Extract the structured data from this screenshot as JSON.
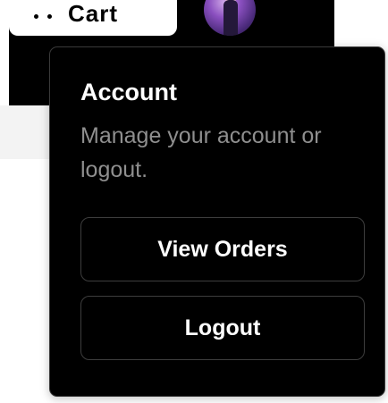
{
  "header": {
    "cart_label": "Cart",
    "avatar_alt": "user avatar"
  },
  "popover": {
    "title": "Account",
    "description": "Manage your account or logout.",
    "view_orders_label": "View Orders",
    "logout_label": "Logout"
  },
  "colors": {
    "popover_bg": "#000000",
    "border": "#3d3d3d",
    "muted_text": "#8f8f8f",
    "text": "#ffffff"
  },
  "icons": [
    "cart-icon",
    "avatar"
  ]
}
